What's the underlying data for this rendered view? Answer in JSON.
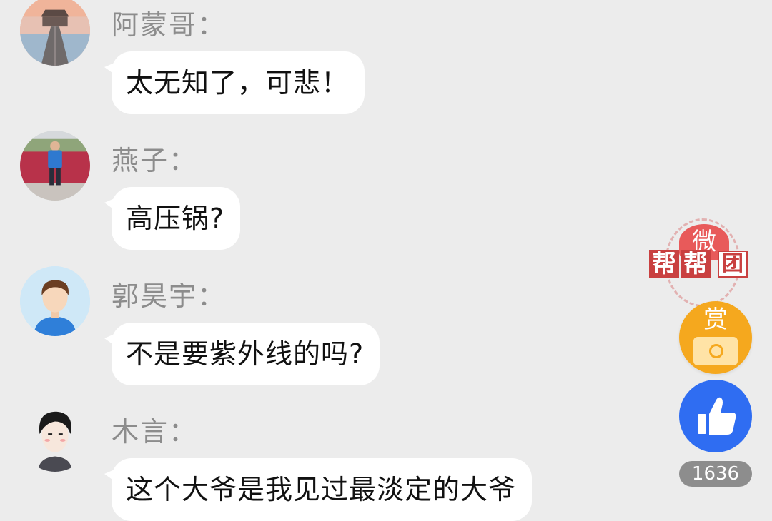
{
  "comments": [
    {
      "name": "阿蒙哥：",
      "text": "太无知了，可悲！",
      "avatar_icon": "pier-photo-avatar"
    },
    {
      "name": "燕子：",
      "text": "高压锅?",
      "avatar_icon": "child-photo-avatar"
    },
    {
      "name": "郭昊宇：",
      "text": "不是要紫外线的吗?",
      "avatar_icon": "cartoon-boy-avatar"
    },
    {
      "name": "木言：",
      "text": "这个大爷是我见过最淡定的大爷",
      "avatar_icon": "cartoon-man-avatar"
    }
  ],
  "actions": {
    "stamp_top": "微",
    "stamp_chars": [
      "帮",
      "帮",
      "团"
    ],
    "reward_label": "赏",
    "like_count": "1636",
    "like_icon": "thumbs-up-icon",
    "reward_icon": "gift-box-icon"
  },
  "colors": {
    "background": "#ececec",
    "bubble": "#ffffff",
    "name_text": "#8c8c8c",
    "like_blue": "#2f6df2",
    "reward_orange": "#f5a81e",
    "stamp_red": "#c94040"
  }
}
